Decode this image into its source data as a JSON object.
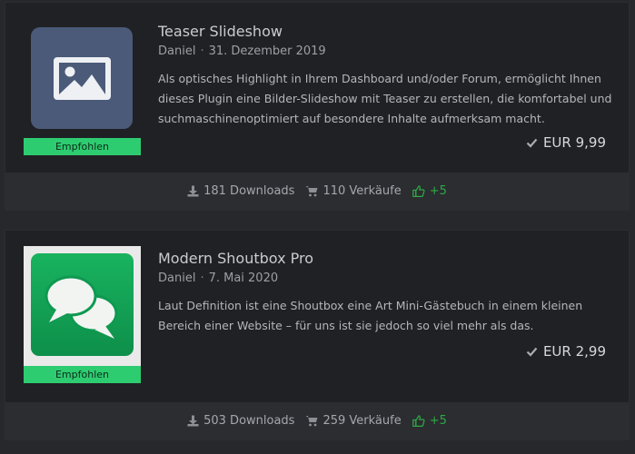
{
  "products": [
    {
      "title": "Teaser Slideshow",
      "author": "Daniel",
      "date": "31. Dezember 2019",
      "description": "Als optisches Highlight in Ihrem Dashboard und/oder Forum, ermöglicht Ihnen dieses Plugin eine Bilder-Slideshow mit Teaser zu erstellen, die komfortabel und suchmaschinenoptimiert auf besondere Inhalte aufmerksam macht.",
      "badge": "Empfohlen",
      "price": "EUR 9,99",
      "downloads": "181 Downloads",
      "sales": "110 Verkäufe",
      "likes": "+5",
      "thumbnail_icon": "image-icon"
    },
    {
      "title": "Modern Shoutbox Pro",
      "author": "Daniel",
      "date": "7. Mai 2020",
      "description": "Laut Definition ist eine Shoutbox eine Art Mini-Gästebuch in einem kleinen Bereich einer Website – für uns ist sie jedoch so viel mehr als das.",
      "badge": "Empfohlen",
      "price": "EUR 2,99",
      "downloads": "503 Downloads",
      "sales": "259 Verkäufe",
      "likes": "+5",
      "thumbnail_icon": "chat-bubbles-icon"
    }
  ],
  "colors": {
    "badge": "#2ecc71",
    "likes": "#2faa44",
    "card_background": "#202124",
    "footer_background": "#2b2d31"
  }
}
